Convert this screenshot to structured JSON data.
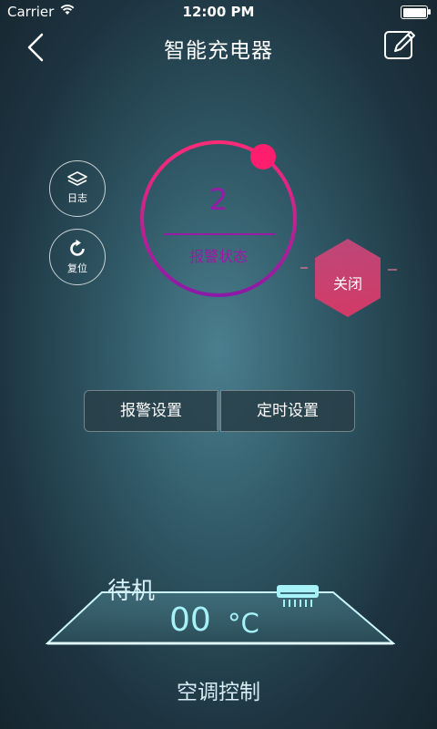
{
  "status_bar": {
    "carrier": "Carrier",
    "time": "12:00 PM"
  },
  "nav": {
    "title": "智能充电器"
  },
  "side_buttons": {
    "log_label": "日志",
    "reset_label": "复位"
  },
  "dial": {
    "value": "2",
    "label": "报警状态"
  },
  "power_button": {
    "label": "关闭"
  },
  "tabs": [
    "报警设置",
    "定时设置"
  ],
  "ac": {
    "mode": "待机",
    "temperature": "00",
    "unit": "°C",
    "control_label": "空调控制"
  },
  "colors": {
    "dial_accent": "#9a1aa7",
    "dial_knob": "#ff1e6e",
    "hex_button": "#e0356a",
    "ac_glow": "#a6f2f8"
  }
}
